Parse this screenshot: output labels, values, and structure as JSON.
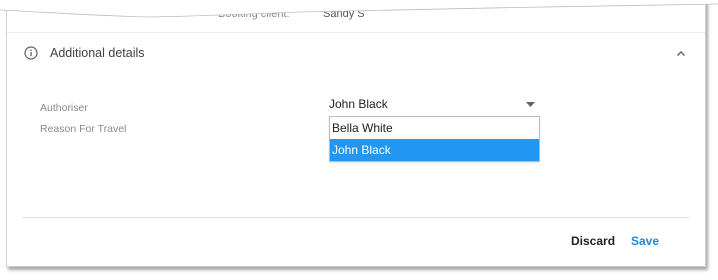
{
  "previous_field": {
    "label": "Booking client:",
    "value": "Sandy S"
  },
  "section": {
    "title": "Additional details",
    "icon": "info-icon",
    "expanded": true
  },
  "fields": {
    "authoriser": {
      "label": "Authoriser",
      "selected_value": "John Black"
    },
    "reason": {
      "label": "Reason For Travel"
    }
  },
  "dropdown": {
    "options": [
      {
        "label": "Bella White",
        "selected": false
      },
      {
        "label": "John Black",
        "selected": true
      }
    ],
    "highlight_color": "#2196f3"
  },
  "actions": {
    "discard_label": "Discard",
    "save_label": "Save",
    "save_color": "#1e88e5"
  }
}
